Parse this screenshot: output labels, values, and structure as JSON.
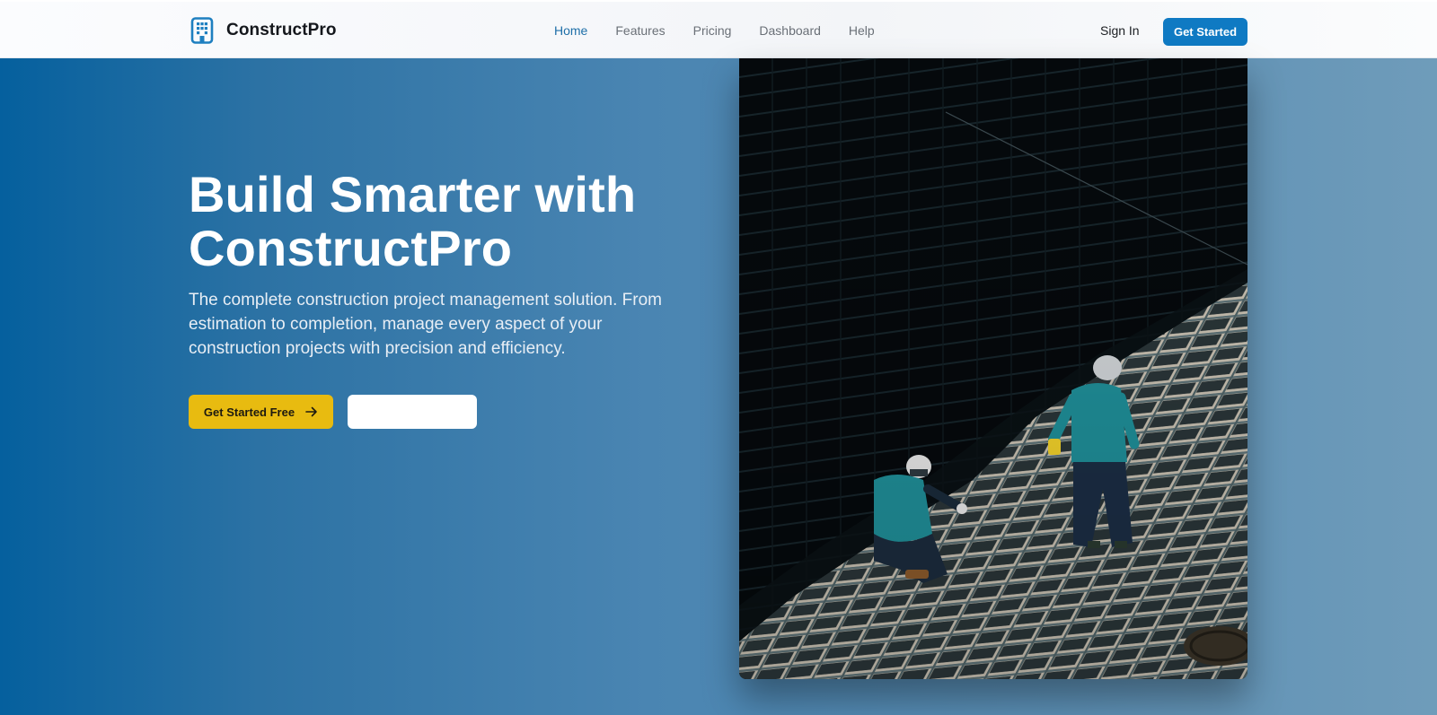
{
  "brand": {
    "name": "ConstructPro",
    "icon": "building-icon",
    "icon_color": "#1e7fc0"
  },
  "nav": {
    "items": [
      {
        "label": "Home",
        "active": true
      },
      {
        "label": "Features",
        "active": false
      },
      {
        "label": "Pricing",
        "active": false
      },
      {
        "label": "Dashboard",
        "active": false
      },
      {
        "label": "Help",
        "active": false
      }
    ]
  },
  "header_actions": {
    "sign_in": "Sign In",
    "get_started": "Get Started"
  },
  "hero": {
    "title_line1": "Build Smarter with",
    "title_line2": "ConstructPro",
    "subtitle": "The complete construction project management solution. From estimation to completion, manage every aspect of your construction projects with precision and efficiency.",
    "primary_cta": "Get Started Free",
    "primary_cta_icon": "arrow-right-icon",
    "secondary_cta": ""
  },
  "hero_image": {
    "description_icon": "construction-workers-photo"
  },
  "colors": {
    "accent": "#0f7ac3",
    "nav_active": "#1e6fa8",
    "cta_yellow": "#e8bb10",
    "hero_gradient_start": "#05609e",
    "hero_gradient_end": "#6f9cba",
    "worker_vest": "#1f8e98"
  }
}
